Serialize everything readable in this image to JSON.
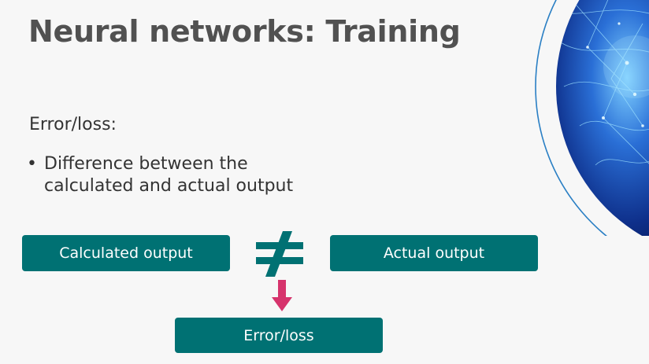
{
  "slide": {
    "title": "Neural networks: Training",
    "subheading": "Error/loss:",
    "bullets": [
      {
        "marker": "•",
        "text": "Difference between the calculated and actual output"
      }
    ]
  },
  "diagram": {
    "calculated_label": "Calculated output",
    "actual_label": "Actual output",
    "error_label": "Error/loss",
    "box_color": "#007173",
    "arrow_color": "#d6336c",
    "not_equal_color": "#007173"
  }
}
